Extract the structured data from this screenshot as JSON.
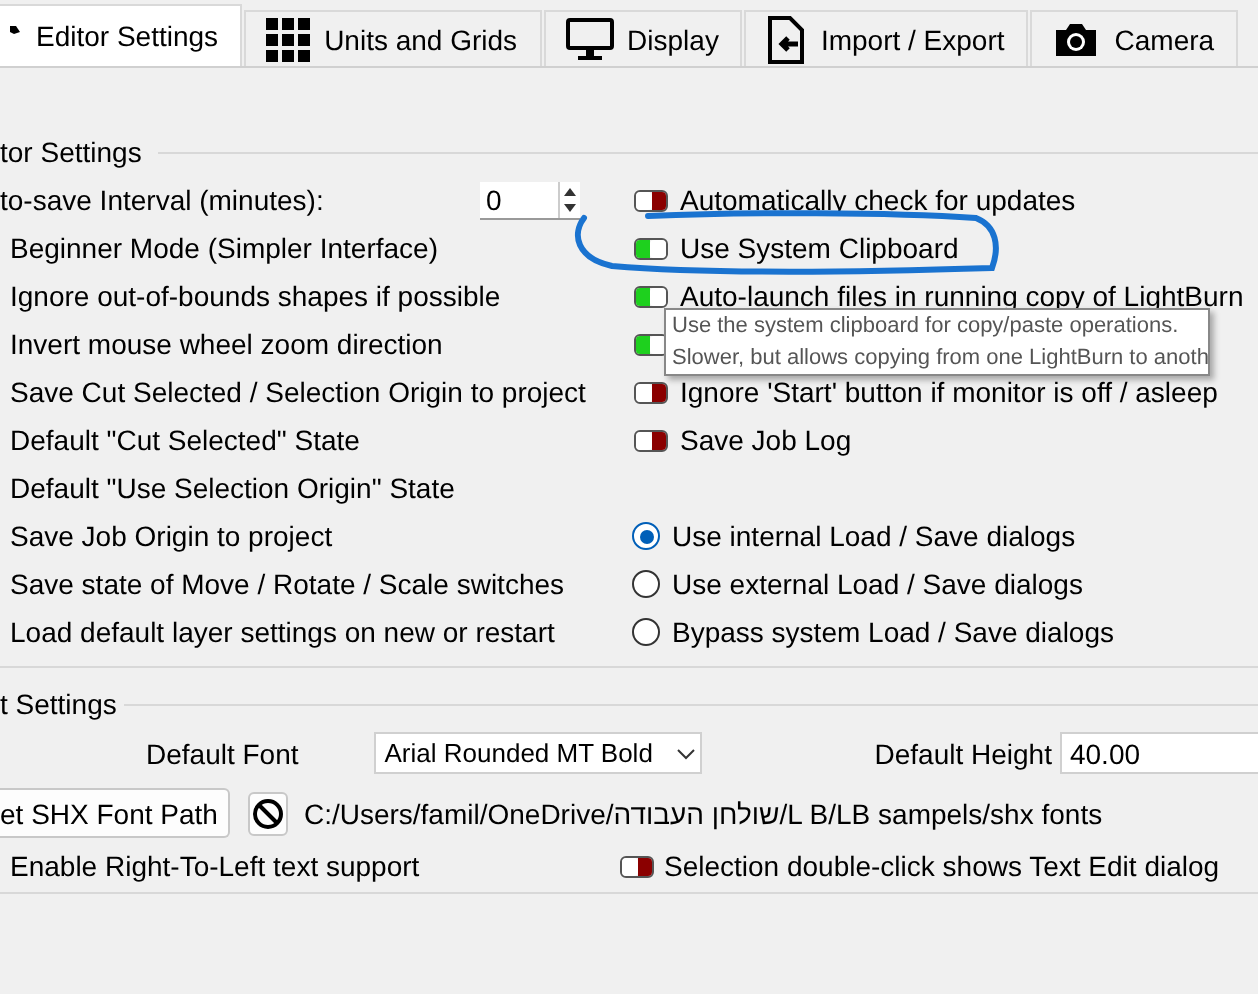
{
  "tabs": [
    {
      "label": "Editor Settings",
      "selected": true
    },
    {
      "label": "Units and Grids",
      "selected": false
    },
    {
      "label": "Display",
      "selected": false
    },
    {
      "label": "Import / Export",
      "selected": false
    },
    {
      "label": "Camera",
      "selected": false
    }
  ],
  "editor_settings": {
    "title": "tor Settings",
    "rows": [
      {
        "label": "to-save Interval (minutes):",
        "spinbox": "0",
        "option": {
          "kind": "toggle",
          "label": "Automatically check for updates",
          "on": false
        }
      },
      {
        "label": "Beginner Mode (Simpler Interface)",
        "option": {
          "kind": "toggle",
          "label": "Use System Clipboard",
          "on": true
        }
      },
      {
        "label": "Ignore out-of-bounds shapes if possible",
        "option": {
          "kind": "toggle",
          "label": "Auto-launch files in running copy of LightBurn",
          "on": true
        }
      },
      {
        "label": "Invert mouse wheel zoom direction",
        "option": {
          "kind": "toggle",
          "on": true
        }
      },
      {
        "label": "Save Cut Selected / Selection Origin to project",
        "option": {
          "kind": "toggle",
          "label": "Ignore 'Start' button if monitor is off / asleep",
          "on": false
        }
      },
      {
        "label": "Default \"Cut Selected\" State",
        "option": {
          "kind": "toggle",
          "label": "Save Job Log",
          "on": false
        }
      },
      {
        "label": "Default \"Use Selection Origin\" State"
      },
      {
        "label": "Save Job Origin to project",
        "option": {
          "kind": "radio",
          "label": "Use internal Load / Save dialogs",
          "selected": true
        }
      },
      {
        "label": "Save state of Move / Rotate / Scale switches",
        "option": {
          "kind": "radio",
          "label": "Use external Load / Save dialogs",
          "selected": false
        }
      },
      {
        "label": "Load default layer settings on new or restart",
        "option": {
          "kind": "radio",
          "label": "Bypass system Load / Save dialogs",
          "selected": false
        }
      }
    ]
  },
  "tooltip": {
    "lines": [
      "Use the system clipboard for copy/paste operations.",
      "Slower, but allows copying from one LightBurn to anoth"
    ]
  },
  "text_settings": {
    "title": "t Settings",
    "default_font": {
      "label": "Default Font",
      "value": "Arial Rounded MT Bold"
    },
    "default_height": {
      "label": "Default Height",
      "value": "40.00"
    },
    "shx_button": "et SHX Font Path",
    "shx_path": "C:/Users/famil/OneDrive/שולחן העבודה/L B/LB sampels/shx fonts",
    "rtl_label": "Enable Right-To-Left text support",
    "dblclick": {
      "label": "Selection double-click shows Text Edit dialog",
      "on": false
    }
  }
}
